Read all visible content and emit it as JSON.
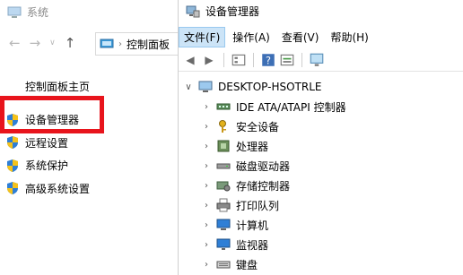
{
  "system_window": {
    "title": "系统",
    "address_text": "控制面板",
    "home_link": "控制面板主页",
    "links": [
      {
        "label": "设备管理器",
        "icon": "shield-icon"
      },
      {
        "label": "远程设置",
        "icon": "shield-icon"
      },
      {
        "label": "系统保护",
        "icon": "shield-icon"
      },
      {
        "label": "高级系统设置",
        "icon": "shield-icon"
      }
    ],
    "highlight_color": "#e8141c"
  },
  "device_manager": {
    "title": "设备管理器",
    "menus": [
      "文件(F)",
      "操作(A)",
      "查看(V)",
      "帮助(H)"
    ],
    "toolbar_icons": [
      "back-icon",
      "forward-icon",
      "properties-icon",
      "help-icon",
      "update-icon",
      "monitor-icon"
    ],
    "computer_name": "DESKTOP-HSOTRLE",
    "categories": [
      {
        "label": "IDE ATA/ATAPI 控制器",
        "icon": "ide-controller-icon"
      },
      {
        "label": "安全设备",
        "icon": "security-device-icon"
      },
      {
        "label": "处理器",
        "icon": "processor-icon"
      },
      {
        "label": "磁盘驱动器",
        "icon": "disk-drive-icon"
      },
      {
        "label": "存储控制器",
        "icon": "storage-controller-icon"
      },
      {
        "label": "打印队列",
        "icon": "print-queue-icon"
      },
      {
        "label": "计算机",
        "icon": "computer-icon"
      },
      {
        "label": "监视器",
        "icon": "monitor-icon"
      },
      {
        "label": "键盘",
        "icon": "keyboard-icon"
      }
    ]
  }
}
